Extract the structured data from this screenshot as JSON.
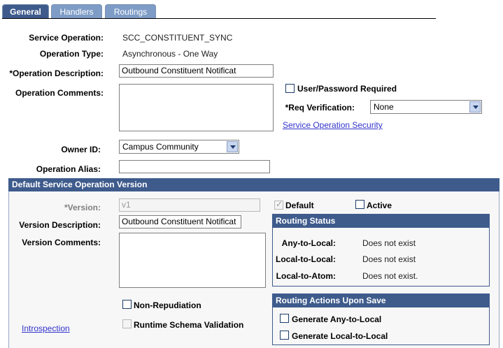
{
  "tabs": [
    {
      "label": "General",
      "active": true
    },
    {
      "label": "Handlers",
      "active": false
    },
    {
      "label": "Routings",
      "active": false
    }
  ],
  "general": {
    "service_operation_label": "Service Operation:",
    "service_operation_value": "SCC_CONSTITUENT_SYNC",
    "operation_type_label": "Operation Type:",
    "operation_type_value": "Asynchronous - One Way",
    "operation_description_label": "*Operation Description:",
    "operation_description_value": "Outbound Constituent Notificat",
    "operation_comments_label": "Operation Comments:",
    "user_password_label": "User/Password Required",
    "req_verification_label": "*Req Verification:",
    "req_verification_value": "None",
    "service_operation_security_link": "Service Operation Security",
    "owner_id_label": "Owner ID:",
    "owner_id_value": "Campus Community",
    "operation_alias_label": "Operation Alias:",
    "operation_alias_value": ""
  },
  "version": {
    "section_title": "Default Service Operation Version",
    "version_label": "*Version:",
    "version_value": "v1",
    "default_label": "Default",
    "active_label": "Active",
    "version_description_label": "Version Description:",
    "version_description_value": "Outbound Constituent Notificat",
    "version_comments_label": "Version Comments:",
    "non_repudiation_label": "Non-Repudiation",
    "runtime_schema_label": "Runtime Schema Validation",
    "introspection_link": "Introspection"
  },
  "routing_status": {
    "title": "Routing Status",
    "rows": [
      {
        "label": "Any-to-Local:",
        "value": "Does not exist"
      },
      {
        "label": "Local-to-Local:",
        "value": "Does not exist"
      },
      {
        "label": "Local-to-Atom:",
        "value": "Does not exist."
      }
    ]
  },
  "routing_actions": {
    "title": "Routing Actions Upon Save",
    "generate_any_to_local": "Generate Any-to-Local",
    "generate_local_to_local": "Generate Local-to-Local"
  },
  "colors": {
    "tab_active": "#3e5b8c",
    "tab_inactive": "#7e9cc6",
    "section_header": "#3e5b8c",
    "link": "#3333cc"
  }
}
